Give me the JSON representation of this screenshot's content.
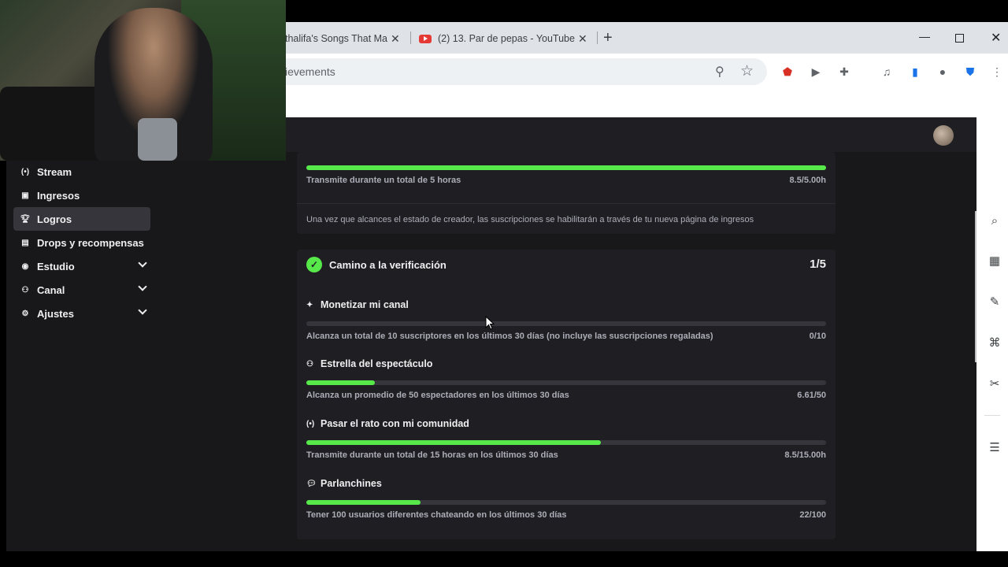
{
  "browser": {
    "tabs": [
      {
        "title": "thalifa's Songs That Ma",
        "active": false
      },
      {
        "title": "(2) 13. Par de pepas - YouTube",
        "active": false
      }
    ],
    "address_fragment": "ievements"
  },
  "sidebar": {
    "items": [
      {
        "label": "Stream",
        "icon": "broadcast-icon",
        "active": false
      },
      {
        "label": "Ingresos",
        "icon": "revenue-icon",
        "active": false
      },
      {
        "label": "Logros",
        "icon": "trophy-icon",
        "active": true
      },
      {
        "label": "Drops y recompensas",
        "icon": "drops-icon",
        "active": false
      },
      {
        "label": "Estudio",
        "icon": "studio-icon",
        "active": false,
        "expandable": true
      },
      {
        "label": "Canal",
        "icon": "channel-icon",
        "active": false,
        "expandable": true
      },
      {
        "label": "Ajustes",
        "icon": "gear-icon",
        "active": false,
        "expandable": true
      }
    ]
  },
  "affiliate_card": {
    "top_goal": {
      "description": "Transmite durante un total de 5 horas",
      "value": "8.5/5.00h",
      "progress": 1.0
    },
    "note": "Una vez que alcances el estado de creador, las suscripciones se habilitarán a través de tu nueva página de ingresos"
  },
  "verification_card": {
    "title": "Camino a la verificación",
    "count": "1/5",
    "milestones": [
      {
        "title": "Monetizar mi canal",
        "icon": "sparkle-icon",
        "description": "Alcanza un total de 10 suscriptores en los últimos 30 días (no incluye las suscripciones regaladas)",
        "value": "0/10",
        "progress": 0.0
      },
      {
        "title": "Estrella del espectáculo",
        "icon": "viewers-icon",
        "description": "Alcanza un promedio de 50 espectadores en los últimos 30 días",
        "value": "6.61/50",
        "progress": 0.132
      },
      {
        "title": "Pasar el rato con mi comunidad",
        "icon": "broadcast-icon",
        "description": "Transmite durante un total de 15 horas en los últimos 30 días",
        "value": "8.5/15.00h",
        "progress": 0.567
      },
      {
        "title": "Parlanchines",
        "icon": "chat-icon",
        "description": "Tener 100 usuarios diferentes chateando en los últimos 30 días",
        "value": "22/100",
        "progress": 0.22
      }
    ]
  },
  "colors": {
    "progress": "#57e84a",
    "background": "#18181a",
    "card": "#1f1f23"
  }
}
